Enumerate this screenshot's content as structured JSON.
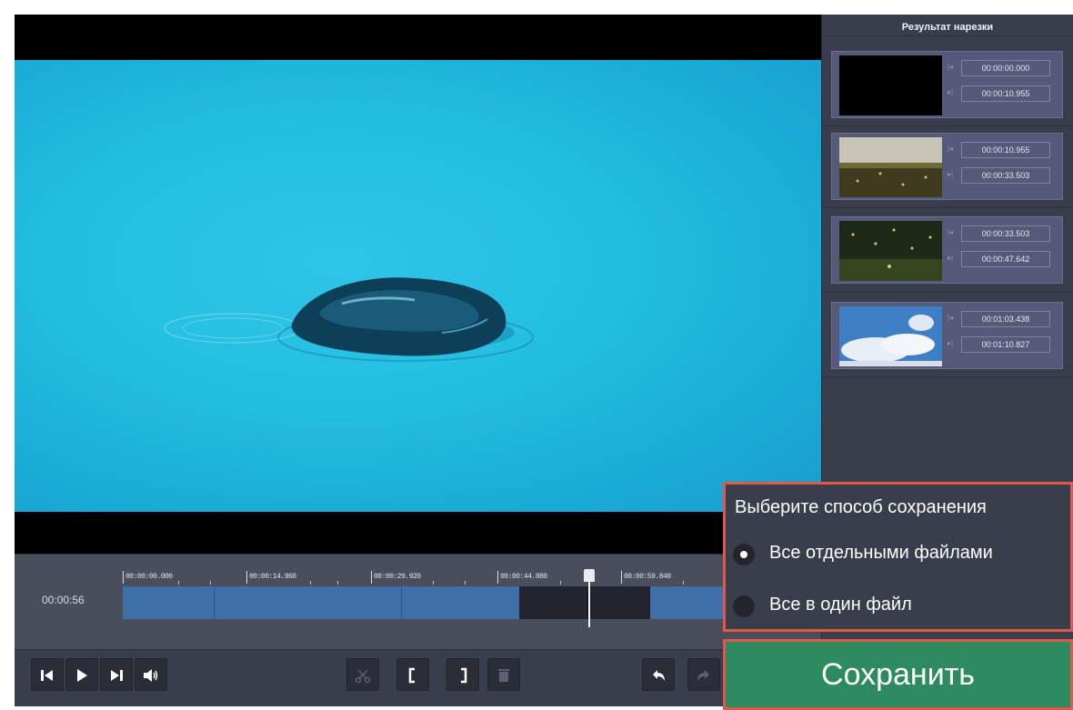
{
  "panel": {
    "title": "Результат нарезки",
    "clips": [
      {
        "start": "00:00:00.000",
        "end": "00:00:10.955",
        "thumbnail": "black-frame"
      },
      {
        "start": "00:00:10.955",
        "end": "00:00:33.503",
        "thumbnail": "field-at-dusk"
      },
      {
        "start": "00:00:33.503",
        "end": "00:00:47.642",
        "thumbnail": "fireflies-in-forest"
      },
      {
        "start": "00:01:03.438",
        "end": "00:01:10.827",
        "thumbnail": "clouds-in-sky"
      }
    ]
  },
  "timeline": {
    "current_time": "00:00:56",
    "ticks": [
      "00:00:00.000",
      "00:00:14.960",
      "00:00:29.920",
      "00:00:44.880",
      "00:00:59.840"
    ]
  },
  "toolbar": {
    "icons": [
      "skip-to-start-icon",
      "play-icon",
      "skip-to-end-icon",
      "volume-icon",
      "scissors-icon",
      "mark-in-icon",
      "mark-out-icon",
      "trash-icon",
      "undo-icon",
      "redo-icon"
    ]
  },
  "save_dialog": {
    "title": "Выберите способ сохранения",
    "options": [
      {
        "label": "Все отдельными файлами",
        "checked": true
      },
      {
        "label": "Все в один файл",
        "checked": false
      }
    ],
    "save_label": "Сохранить"
  },
  "colors": {
    "accent_save": "#2e8a5f",
    "highlight_border": "#e0584a",
    "segment_blue": "#3e6fa6"
  }
}
